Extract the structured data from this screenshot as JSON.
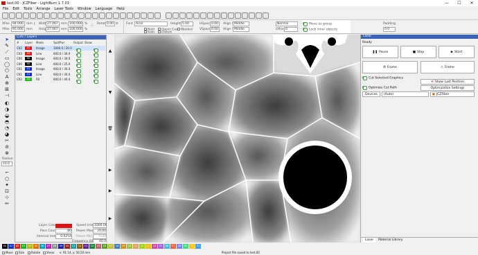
{
  "window": {
    "title": "test.00 - JCZFiber - LightBurn 1.7.03",
    "minimize": "—",
    "maximize": "☐",
    "close": "✕"
  },
  "menu": [
    "File",
    "Edit",
    "Tools",
    "Arrange",
    "Laser Tools",
    "Window",
    "Language",
    "Help"
  ],
  "toolbar2": {
    "xpos": "94.000",
    "ypos": "95.000",
    "width": "27.067",
    "height": "27.067",
    "w_pct": "100.000",
    "h_pct": "100.000",
    "unit": "mm",
    "pct": "%",
    "rotate_label": "Rotate",
    "rotate": "0.00",
    "font_label": "Font",
    "font": "Arial",
    "height_label": "Height",
    "font_height": "5.00",
    "bold": "Bold",
    "italic": "Italic",
    "upper_case": "Upper Case",
    "distort": "Distort",
    "welded": "Welded",
    "hspace_label": "HSpace",
    "hspace": "0.00",
    "vspace_label": "VSpace",
    "vspace": "0.00",
    "align_x_label": "Align X",
    "align_x": "Middle",
    "align_y_label": "Align Y",
    "align_y": "Middle",
    "normal": "Normal",
    "offset_label": "Offset",
    "offset": "0",
    "move_as_group": "Move as group",
    "lock_inner": "Lock inner objects",
    "padding_label": "Padding",
    "padding": "0.0"
  },
  "cuts": {
    "header": "Cuts / Layers",
    "columns": [
      "#",
      "Layer",
      "Mode",
      "Spd/Pwr",
      "Output",
      "Show"
    ],
    "rows": [
      {
        "num": "C02",
        "layer": "02",
        "color": "#e02020",
        "mode": "Image",
        "spd": "1000.0 / 20.0"
      },
      {
        "num": "C03",
        "layer": "03",
        "color": "#e02020",
        "mode": "Line",
        "spd": "600.0 / 30.0"
      },
      {
        "num": "C00",
        "layer": "00",
        "color": "#0a0a0a",
        "mode": "Image",
        "spd": "600.0 / 30.0"
      },
      {
        "num": "C00",
        "layer": "00",
        "color": "#0a0a0a",
        "mode": "Line",
        "spd": "600.0 / 25.0"
      },
      {
        "num": "C01",
        "layer": "01",
        "color": "#1030d0",
        "mode": "Image",
        "spd": "600.0 / 30.0"
      },
      {
        "num": "C01",
        "layer": "01",
        "color": "#1030d0",
        "mode": "Line",
        "spd": "600.0 / 30.0"
      },
      {
        "num": "C02",
        "layer": "02",
        "color": "#20c020",
        "mode": "Fill",
        "spd": "600.0 / 40.0"
      }
    ],
    "layer_color_label": "Layer Color",
    "pass_count_label": "Pass Count",
    "pass_count": "80",
    "interval_label": "Interval (mm)",
    "interval": "0.0254",
    "speed_label": "Speed (mm/s)",
    "speed": "1000.00",
    "power_max_label": "Power Max (%)",
    "power_max": "20.00",
    "power_min_label": "Power Min (%)",
    "power_min": "0.00",
    "frequency_label": "Frequency (kHz)",
    "frequency": "40.0"
  },
  "left_tools": {
    "radius_label": "Radius:",
    "radius": "10.0"
  },
  "laser": {
    "header": "Laser",
    "status": "Ready",
    "pause": "Pause",
    "stop": "Stop",
    "start": "Start",
    "frame1": "Frame",
    "frame2": "Frame",
    "cut_selected": "Cut Selected Graphics",
    "optimize": "Optimize Cut Path",
    "show_last": "Show Last Position",
    "opt_settings": "Optimization Settings",
    "devices_label": "Devices",
    "port": "(Auto)",
    "device": "JCZFiber",
    "tab_laser": "Laser",
    "tab_material": "Material Library"
  },
  "palette": [
    {
      "label": "00",
      "color": "#000000"
    },
    {
      "label": "01",
      "color": "#1030d0"
    },
    {
      "label": "02",
      "color": "#e02020"
    },
    {
      "label": "03",
      "color": "#20b020"
    },
    {
      "label": "04",
      "color": "#b8b800"
    },
    {
      "label": "05",
      "color": "#e07000"
    },
    {
      "label": "06",
      "color": "#00a0c0"
    },
    {
      "label": "07",
      "color": "#c020c0"
    },
    {
      "label": "08",
      "color": "#909090"
    },
    {
      "label": "09",
      "color": "#2020a0"
    },
    {
      "label": "10",
      "color": "#a02020"
    },
    {
      "label": "11",
      "color": "#20a0a0"
    },
    {
      "label": "12",
      "color": "#906000"
    },
    {
      "label": "13",
      "color": "#6020a0"
    },
    {
      "label": "14",
      "color": "#208040"
    },
    {
      "label": "15",
      "color": "#c06060"
    },
    {
      "label": "16",
      "color": "#60a020"
    },
    {
      "label": "17",
      "color": "#c0c040"
    },
    {
      "label": "18",
      "color": "#4080c0"
    },
    {
      "label": "19",
      "color": "#d09020"
    },
    {
      "label": "20",
      "color": "#a0c040"
    },
    {
      "label": "21",
      "color": "#e0a060"
    },
    {
      "label": "22",
      "color": "#a0d000"
    },
    {
      "label": "23",
      "color": "#e0c000"
    },
    {
      "label": "24",
      "color": "#e040a0"
    },
    {
      "label": "25",
      "color": "#a060e0"
    },
    {
      "label": "26",
      "color": "#40c0e0"
    },
    {
      "label": "27",
      "color": "#ff6040"
    },
    {
      "label": "28",
      "color": "#8080ff"
    },
    {
      "label": "29",
      "color": "#40e080"
    },
    {
      "label": "T1",
      "color": "#ffc000"
    },
    {
      "label": "T2",
      "color": "#40a0ff"
    }
  ],
  "status": {
    "move": "Move",
    "size": "Size",
    "rotate": "Rotate",
    "shear": "Shear",
    "coords": "x: 91.14, y: 56.50 mm",
    "message": "Project file saved to test.00"
  }
}
